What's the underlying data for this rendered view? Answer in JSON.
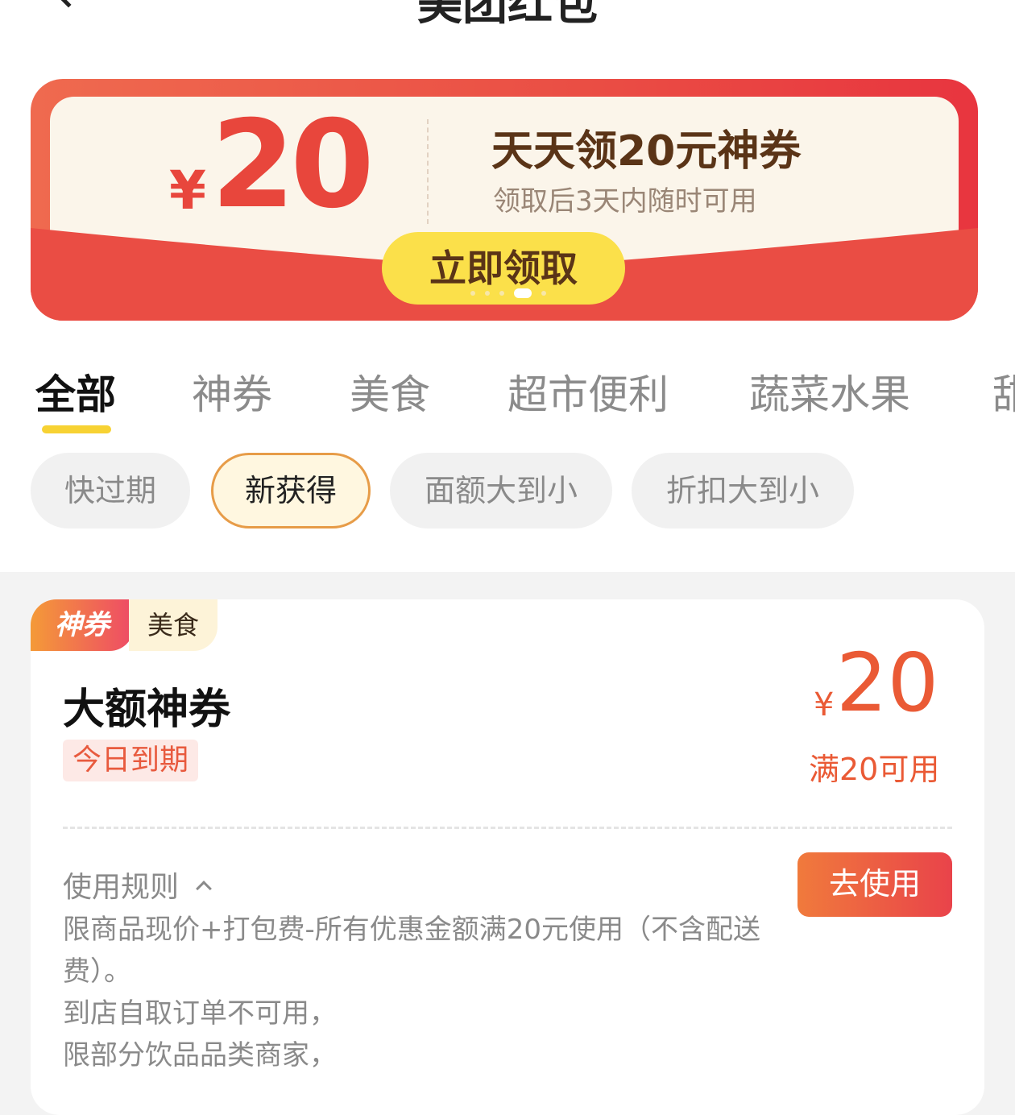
{
  "header": {
    "title": "美团红包"
  },
  "banner": {
    "currency": "¥",
    "amount": "20",
    "title": "天天领20元神券",
    "subtitle": "领取后3天内随时可用",
    "button_label": "立即领取"
  },
  "tabs": [
    {
      "label": "全部",
      "active": true
    },
    {
      "label": "神券",
      "active": false
    },
    {
      "label": "美食",
      "active": false
    },
    {
      "label": "超市便利",
      "active": false
    },
    {
      "label": "蔬菜水果",
      "active": false
    },
    {
      "label": "甜",
      "active": false
    }
  ],
  "filters": [
    {
      "label": "快过期",
      "active": false
    },
    {
      "label": "新获得",
      "active": true
    },
    {
      "label": "面额大到小",
      "active": false
    },
    {
      "label": "折扣大到小",
      "active": false
    }
  ],
  "coupon": {
    "badge_primary": "神券",
    "badge_secondary": "美食",
    "title": "大额神券",
    "expire_tag": "今日到期",
    "currency": "¥",
    "value": "20",
    "condition": "满20可用",
    "rules_label": "使用规则",
    "use_button": "去使用",
    "rules": [
      "限商品现价+打包费-所有优惠金额满20元使用（不含配送",
      "费）。",
      "到店自取订单不可用，",
      "限部分饮品品类商家，"
    ]
  },
  "colors": {
    "accent_red": "#e8463c",
    "button_yellow": "#fbe04a",
    "tab_underline": "#f7d233",
    "price_orange": "#ea5a35"
  }
}
